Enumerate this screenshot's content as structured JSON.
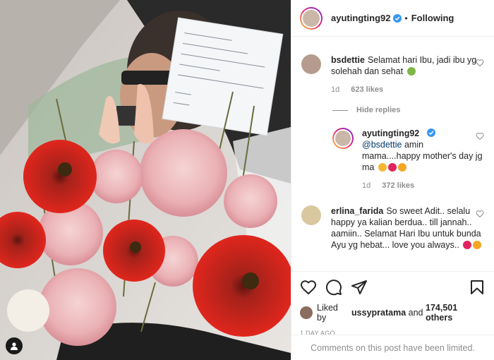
{
  "post": {
    "author": "ayutingting92",
    "follow_state": "Following",
    "dot": "•",
    "photo_note_lines": [
      "Dear Ayu tingting,",
      "Happy mother's day!",
      "Sending you lots of love",
      "and prayers !",
      "Let's work together bros",
      "Love,",
      "Aditi"
    ]
  },
  "comments": [
    {
      "user": "bsdettie",
      "text": "Selamat hari Ibu, jadi ibu yg solehah dan sehat",
      "time": "1d",
      "likes": "623 likes",
      "hide_replies": "Hide replies",
      "reply": {
        "user": "ayutingting92",
        "mention": "@bsdettie",
        "text": " amin mama....happy mother's day jg ma",
        "time": "1d",
        "likes": "372 likes"
      }
    },
    {
      "user": "erlina_farida",
      "text": "So sweet Adit.. selalu happy ya kalian berdua.. till jannah.. aamiin.. Selamat Hari Ibu untuk bunda Ayu yg hebat... love you always..",
      "time": "",
      "likes": ""
    }
  ],
  "likes_summary": {
    "prefix": "Liked by ",
    "user": "ussypratama",
    "middle": " and ",
    "count": "174,501 others"
  },
  "posted_ago": "1 DAY AGO",
  "comments_notice": "Comments on this post have been limited.",
  "icons": [
    "heart-icon",
    "comment-icon",
    "share-icon",
    "bookmark-icon",
    "verified-badge-icon",
    "user-tag-icon"
  ],
  "colors": {
    "verified": "#3897f0",
    "muted": "#8e8e8e",
    "mention": "#00376b"
  }
}
